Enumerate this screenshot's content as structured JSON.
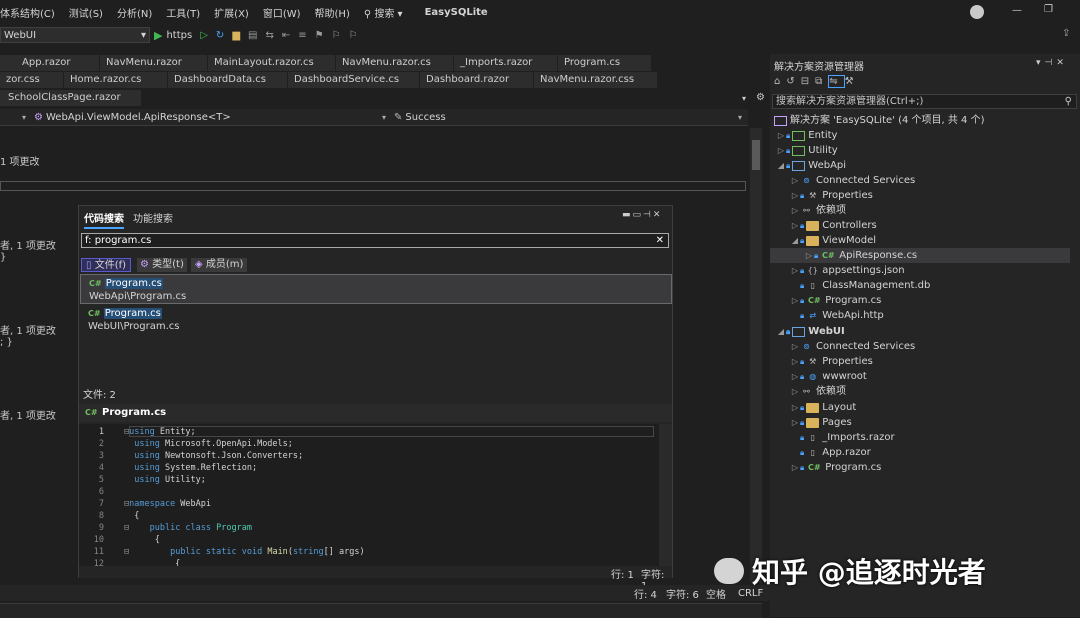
{
  "menu": [
    "体系结构(C)",
    "测试(S)",
    "分析(N)",
    "工具(T)",
    "扩展(X)",
    "窗口(W)",
    "帮助(H)"
  ],
  "search_menu": "搜索",
  "app_title": "EasySQLite",
  "toolbar": {
    "project_combo": "WebUI",
    "run_label": "https"
  },
  "tabs_row1": [
    "App.razor",
    "NavMenu.razor",
    "MainLayout.razor.cs",
    "NavMenu.razor.cs",
    "_Imports.razor",
    "Program.cs"
  ],
  "tabs_row2": [
    "zor.css",
    "Home.razor.cs",
    "DashboardData.cs",
    "DashboardService.cs",
    "Dashboard.razor",
    "NavMenu.razor.css"
  ],
  "tabs_row3": [
    "SchoolClassPage.razor"
  ],
  "navbar": {
    "member": "WebApi.ViewModel.ApiResponse<T>",
    "method": "Success"
  },
  "editor_bg_text": [
    "1 项更改",
    "者, 1 项更改",
    "}",
    "者, 1 项更改",
    "; }",
    "者, 1 项更改"
  ],
  "solution_explorer": {
    "title": "解决方案资源管理器",
    "search_placeholder": "搜索解决方案资源管理器(Ctrl+;)",
    "items": [
      "解决方案 'EasySQLite' (4 个项目, 共 4 个)",
      "Entity",
      "Utility",
      "WebApi",
      "Connected Services",
      "Properties",
      "依赖项",
      "Controllers",
      "ViewModel",
      "ApiResponse.cs",
      "appsettings.json",
      "ClassManagement.db",
      "Program.cs",
      "WebApi.http",
      "WebUI",
      "Connected Services",
      "Properties",
      "wwwroot",
      "依赖项",
      "Layout",
      "Pages",
      "_Imports.razor",
      "App.razor",
      "Program.cs"
    ]
  },
  "search_popup": {
    "tabs": [
      "代码搜索",
      "功能搜索"
    ],
    "query": "f: program.cs",
    "filters": [
      "文件(f)",
      "类型(t)",
      "成员(m)"
    ],
    "results": [
      {
        "name": "Program.cs",
        "path": "WebApi\\Program.cs"
      },
      {
        "name": "Program.cs",
        "path": "WebUI\\Program.cs"
      }
    ],
    "count_label": "文件: 2",
    "preview_title": "Program.cs",
    "preview_line_nums": [
      "1",
      "2",
      "3",
      "4",
      "5",
      "6",
      "7",
      "8",
      "9",
      "10",
      "11",
      "12"
    ],
    "status_line": "行: 1",
    "status_char": "字符: 1"
  },
  "statusbar": {
    "line": "行: 4",
    "char": "字符: 6",
    "space": "空格",
    "eol": "CRLF"
  },
  "watermark": "知乎 @追逐时光者",
  "colors": {
    "accent": "#4aa3ff",
    "highlight": "#264f78",
    "folder": "#d9b35b"
  }
}
